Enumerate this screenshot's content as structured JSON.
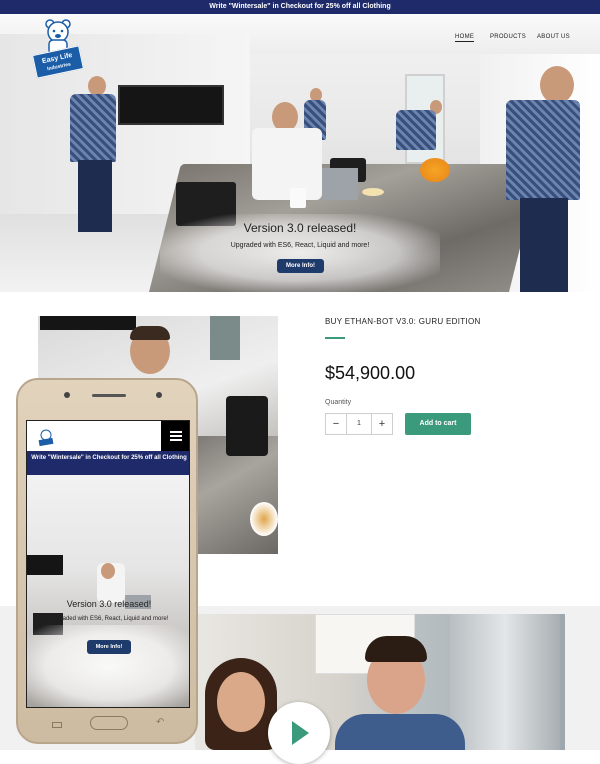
{
  "promo_banner": "Write \"Wintersale\" in Checkout for 25% off all Clothing",
  "logo": {
    "line1": "Easy Life",
    "line2": "Industries"
  },
  "nav": [
    {
      "label": "HOME",
      "active": true
    },
    {
      "label": "PRODUCTS",
      "active": false
    },
    {
      "label": "ABOUT US",
      "active": false
    }
  ],
  "hero": {
    "title": "Version 3.0 released!",
    "subtitle": "Upgraded with ES6, React, Liquid and more!",
    "button": "More Info!"
  },
  "product": {
    "title": "BUY ETHAN-BOT V3.0: GURU EDITION",
    "price": "$54,900.00",
    "quantity_label": "Quantity",
    "quantity_value": "1",
    "minus": "−",
    "plus": "+",
    "add_to_cart": "Add to cart"
  },
  "mobile": {
    "banner": "Write \"Wintersale\" in Checkout for 25% off all Clothing",
    "hero_title": "Version 3.0 released!",
    "hero_subtitle": "Upgraded with ES6, React, Liquid and more!",
    "hero_button": "More Info!"
  },
  "colors": {
    "banner_bg": "#1f2a6b",
    "accent_green": "#3c9a7c",
    "button_navy": "#1f3b6b",
    "logo_blue": "#1c5da8"
  },
  "icons": [
    "bear-logo-icon",
    "hamburger-menu-icon",
    "play-icon"
  ]
}
